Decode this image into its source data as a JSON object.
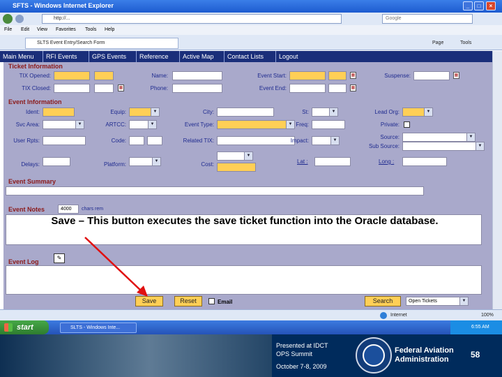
{
  "browser": {
    "title": "SFTS - Windows Internet Explorer",
    "address": "http://...",
    "search_placeholder": "Google",
    "menu": [
      "File",
      "Edit",
      "View",
      "Favorites",
      "Tools",
      "Help"
    ],
    "tab_title": "SLTS Event Entry/Search Form",
    "tools": [
      "Page",
      "Tools"
    ],
    "status_zone": "Internet",
    "zoom": "100%"
  },
  "nav": [
    "Main Menu",
    "RFI Events",
    "GPS Events",
    "Reference",
    "Active Map",
    "Contact Lists",
    "Logout"
  ],
  "ticket": {
    "heading": "Ticket Information",
    "tix_opened": "TIX Opened:",
    "tix_closed": "TIX Closed:",
    "name": "Name:",
    "phone": "Phone:",
    "event_start": "Event Start:",
    "event_end": "Event End:",
    "suspense": "Suspense:"
  },
  "event": {
    "heading": "Event Information",
    "ident": "Ident:",
    "equip": "Equip:",
    "city": "City:",
    "st": "St:",
    "lead_org": "Lead Org:",
    "svc_area": "Svc Area:",
    "artcc": "ARTCC:",
    "event_type": "Event Type:",
    "freq": "Freq:",
    "private": "Private:",
    "user_rpts": "User Rpts:",
    "code": "Code:",
    "related_tix": "Related TIX:",
    "impact": "Impact:",
    "source": "Source:",
    "sub_source": "Sub Source:",
    "delays": "Delays:",
    "platform": "Platform:",
    "cost": "Cost:",
    "lat": "Lat :",
    "long": "Long :"
  },
  "summary": {
    "heading": "Event Summary"
  },
  "notes": {
    "heading": "Event Notes",
    "count": "4000",
    "chars_rem": "chars rem"
  },
  "log": {
    "heading": "Event Log"
  },
  "buttons": {
    "save": "Save",
    "reset": "Reset",
    "email": "Email",
    "search": "Search",
    "open_tickets": "Open Tickets"
  },
  "annotation": "Save – This button executes the save ticket function into the Oracle database.",
  "taskbar": {
    "start": "start",
    "app": "SLTS - Windows Inte...",
    "clock": "6:55 AM"
  },
  "footer": {
    "presented": "Presented at IDCT",
    "summit": "OPS Summit",
    "date": "October 7-8, 2009",
    "agency_line1": "Federal Aviation",
    "agency_line2": "Administration",
    "page_number": "58"
  },
  "colors": {
    "nav_bg": "#1a2e7a",
    "form_bg": "#a9a9cb",
    "required": "#ffcf56",
    "arrow": "#e01010",
    "footer_bg": "#002b5c"
  }
}
